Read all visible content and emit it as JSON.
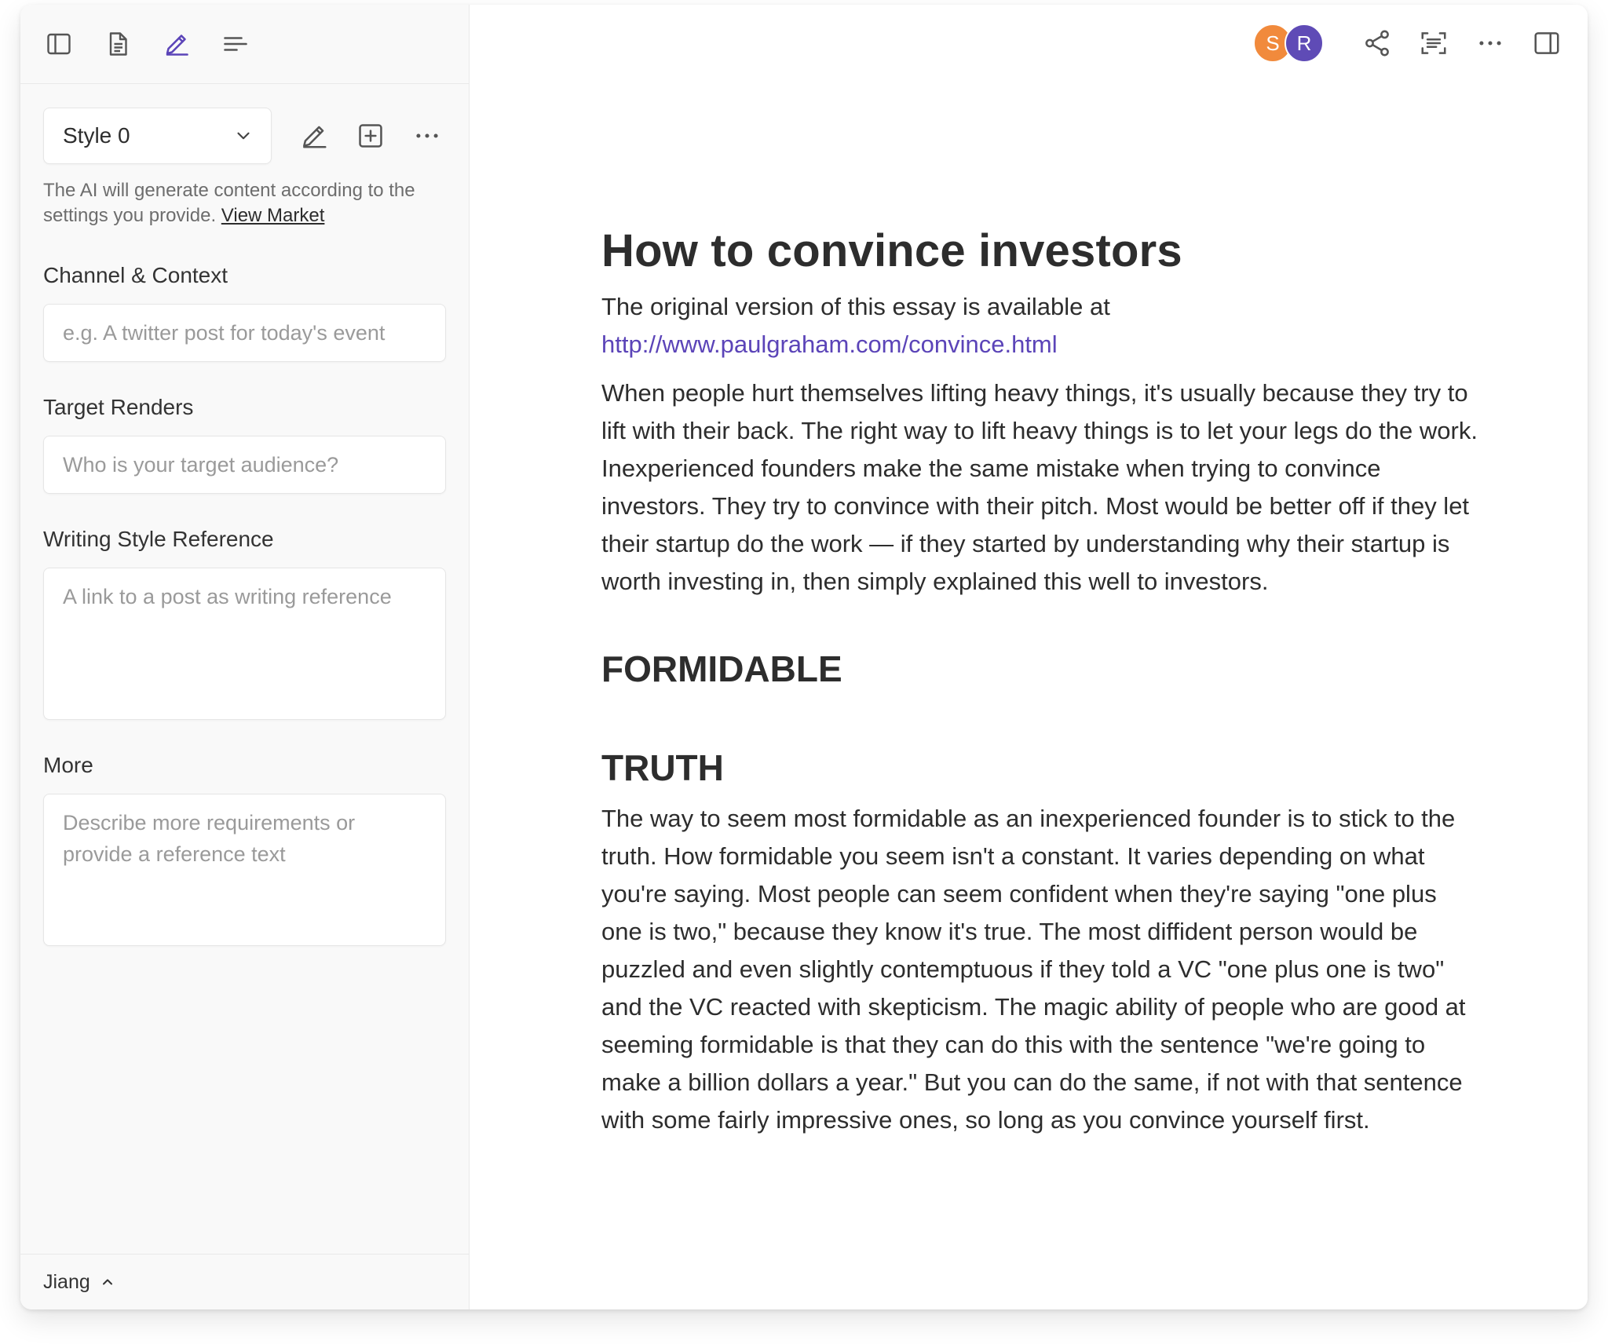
{
  "colors": {
    "accent": "#5b44b8",
    "avatar_s": "#f18a3c",
    "avatar_r": "#5f4bb6"
  },
  "sidebar": {
    "toolbar_icons": [
      "sidebar-toggle-icon",
      "document-icon",
      "pen-icon",
      "outline-icon"
    ],
    "style_select": {
      "value": "Style 0"
    },
    "style_actions": [
      "edit-icon",
      "add-icon",
      "more-icon"
    ],
    "hint": {
      "text": "The AI will generate content according to the settings you provide.",
      "link": "View Market"
    },
    "fields": {
      "channel": {
        "label": "Channel & Context",
        "placeholder": "e.g. A twitter post for today's event"
      },
      "target": {
        "label": "Target Renders",
        "placeholder": "Who is your target audience?"
      },
      "style_ref": {
        "label": "Writing Style Reference",
        "placeholder": "A link to a post as writing reference"
      },
      "more": {
        "label": "More",
        "placeholder": "Describe more requirements or provide a reference text"
      }
    },
    "footer": {
      "user": "Jiang"
    }
  },
  "header": {
    "avatars": [
      "S",
      "R"
    ],
    "icons": [
      "share-icon",
      "scan-icon",
      "more-icon",
      "panel-icon"
    ]
  },
  "document": {
    "title": "How to convince investors",
    "intro_text": "The original version of this essay is available at ",
    "intro_link": "http://www.paulgraham.com/convince.html",
    "paragraph1": "When people hurt themselves lifting heavy things, it's usually because they try to lift with their back. The right way to lift heavy things is to let your legs do the work. Inexperienced founders make the same mistake when trying to convince investors. They try to convince with their pitch. Most would be better off if they let their startup do the work — if they started by understanding why their startup is worth investing in, then simply explained this well to investors.",
    "heading1": "FORMIDABLE",
    "heading2": "TRUTH",
    "paragraph2": "The way to seem most formidable as an inexperienced founder is to stick to the truth. How formidable you seem isn't a constant. It varies depending on what you're saying. Most people can seem confident when they're saying \"one plus one is two,\" because they know it's true. The most diffident person would be puzzled and even slightly contemptuous if they told a VC \"one plus one is two\" and the VC reacted with skepticism. The magic ability of people who are good at seeming formidable is that they can do this with the sentence \"we're going to make a billion dollars a year.\" But you can do the same, if not with that sentence with some fairly impressive ones, so long as you convince yourself first."
  }
}
